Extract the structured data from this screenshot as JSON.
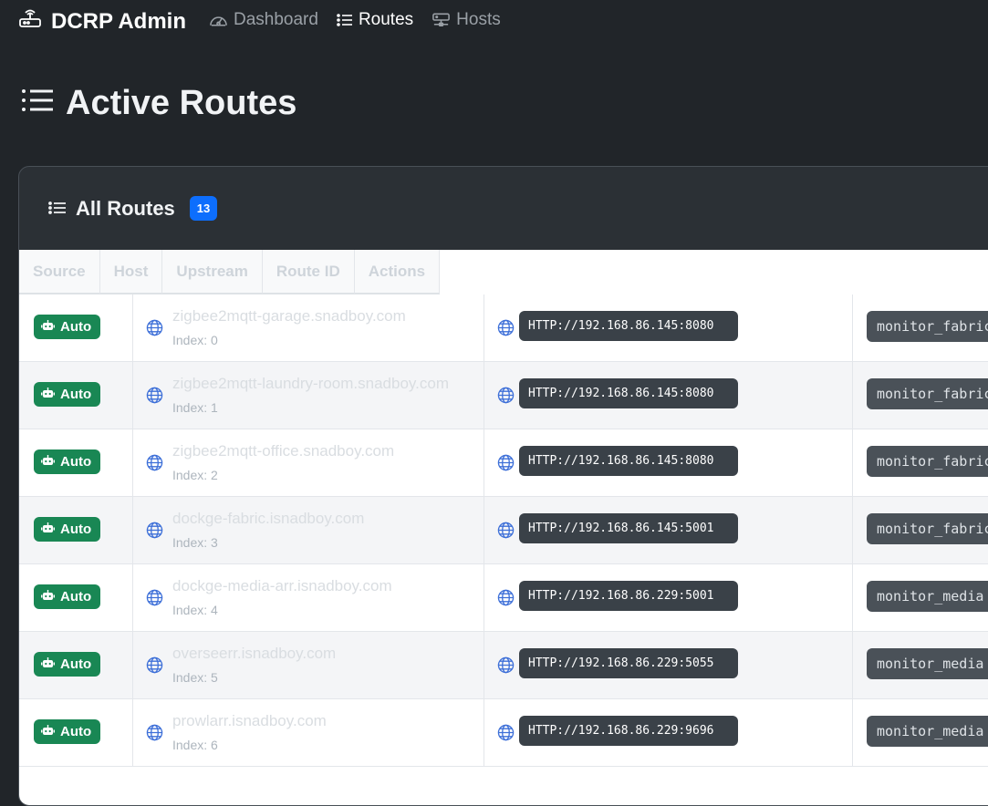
{
  "navbar": {
    "brand": "DCRP Admin",
    "links": [
      {
        "label": "Dashboard",
        "icon": "speedometer-icon",
        "active": false
      },
      {
        "label": "Routes",
        "icon": "list-icon",
        "active": true
      },
      {
        "label": "Hosts",
        "icon": "hdd-network-icon",
        "active": false
      }
    ]
  },
  "page": {
    "title": "Active Routes"
  },
  "card": {
    "title": "All Routes",
    "count": "13",
    "columns": [
      "Source",
      "Host",
      "Upstream",
      "Route ID",
      "Actions"
    ]
  },
  "routes": [
    {
      "source": "Auto",
      "host": "zigbee2mqtt-garage.snadboy.com",
      "index": "Index: 0",
      "upstream": "HTTP://192.168.86.145:8080",
      "route_id": "monitor_fabric"
    },
    {
      "source": "Auto",
      "host": "zigbee2mqtt-laundry-room.snadboy.com",
      "index": "Index: 1",
      "upstream": "HTTP://192.168.86.145:8080",
      "route_id": "monitor_fabric"
    },
    {
      "source": "Auto",
      "host": "zigbee2mqtt-office.snadboy.com",
      "index": "Index: 2",
      "upstream": "HTTP://192.168.86.145:8080",
      "route_id": "monitor_fabric"
    },
    {
      "source": "Auto",
      "host": "dockge-fabric.isnadboy.com",
      "index": "Index: 3",
      "upstream": "HTTP://192.168.86.145:5001",
      "route_id": "monitor_fabric"
    },
    {
      "source": "Auto",
      "host": "dockge-media-arr.isnadboy.com",
      "index": "Index: 4",
      "upstream": "HTTP://192.168.86.229:5001",
      "route_id": "monitor_media"
    },
    {
      "source": "Auto",
      "host": "overseerr.isnadboy.com",
      "index": "Index: 5",
      "upstream": "HTTP://192.168.86.229:5055",
      "route_id": "monitor_media"
    },
    {
      "source": "Auto",
      "host": "prowlarr.isnadboy.com",
      "index": "Index: 6",
      "upstream": "HTTP://192.168.86.229:9696",
      "route_id": "monitor_media"
    }
  ],
  "colors": {
    "background": "#212529",
    "accent": "#0d6efd",
    "auto_badge": "#198754"
  }
}
